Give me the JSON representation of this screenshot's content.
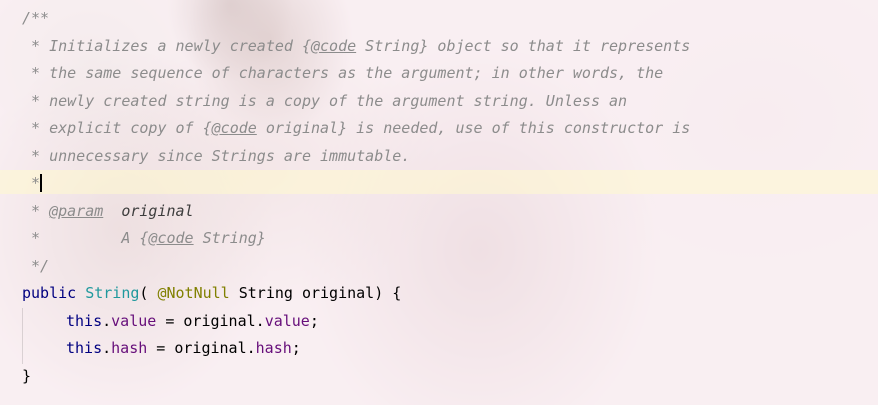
{
  "editor": {
    "doc": {
      "open": "/**",
      "l1": " * Initializes a newly created {",
      "l1_tag": "@code",
      "l1_rest": " String} object so that it represents",
      "l2": " * the same sequence of characters as the argument; in other words, the",
      "l3": " * newly created string is a copy of the argument string. Unless an",
      "l4": " * explicit copy of {",
      "l4_tag": "@code",
      "l4_rest": " original} is needed, use of this constructor is",
      "l5": " * unnecessary since Strings are immutable.",
      "l6": " *",
      "param_prefix": " * ",
      "param_tag": "@param",
      "param_gap": "  ",
      "param_name": "original",
      "a_line": " *         A {",
      "a_tag": "@code",
      "a_rest": " String}",
      "close": " */"
    },
    "code": {
      "sig_kw": "public",
      "sig_sp1": " ",
      "sig_type": "String",
      "sig_paren": "( ",
      "sig_anno": "@NotNull",
      "sig_rest": " String original) {",
      "b1_this": "this",
      "b1_dot": ".",
      "b1_field": "value",
      "b1_eq": " = original.",
      "b1_field2": "value",
      "b1_semi": ";",
      "b2_this": "this",
      "b2_dot": ".",
      "b2_field": "hash",
      "b2_eq": " = original.",
      "b2_field2": "hash",
      "b2_semi": ";",
      "close": "}"
    }
  }
}
